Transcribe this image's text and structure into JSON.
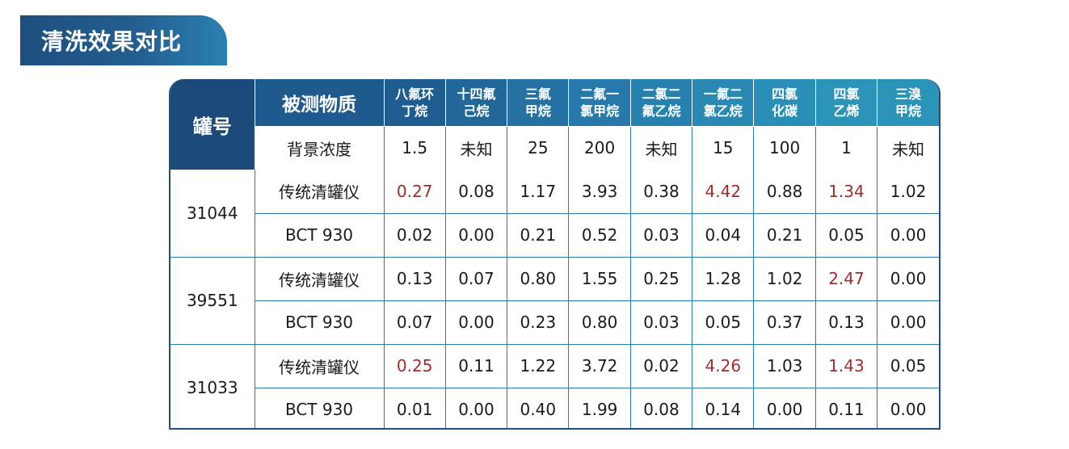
{
  "title": "清洗效果对比",
  "table": {
    "corner_label": "罐号",
    "property_label": "被测物质",
    "columns": [
      "八氟环\n丁烷",
      "十四氟\n己烷",
      "三氟\n甲烷",
      "二氟一\n氯甲烷",
      "二氯二\n氟乙烷",
      "一氟二\n氯乙烷",
      "四氯\n化碳",
      "四氯\n乙烯",
      "三溴\n甲烷"
    ],
    "background_row": {
      "label": "背景浓度",
      "values": [
        "1.5",
        "未知",
        "25",
        "200",
        "未知",
        "15",
        "100",
        "1",
        "未知"
      ]
    },
    "tanks": [
      {
        "id": "31044",
        "rows": [
          {
            "label": "传统清罐仪",
            "values": [
              "0.27",
              "0.08",
              "1.17",
              "3.93",
              "0.38",
              "4.42",
              "0.88",
              "1.34",
              "1.02"
            ],
            "highlight": [
              0,
              5,
              7
            ]
          },
          {
            "label": "BCT 930",
            "values": [
              "0.02",
              "0.00",
              "0.21",
              "0.52",
              "0.03",
              "0.04",
              "0.21",
              "0.05",
              "0.00"
            ],
            "highlight": []
          }
        ]
      },
      {
        "id": "39551",
        "rows": [
          {
            "label": "传统清罐仪",
            "values": [
              "0.13",
              "0.07",
              "0.80",
              "1.55",
              "0.25",
              "1.28",
              "1.02",
              "2.47",
              "0.00"
            ],
            "highlight": [
              7
            ]
          },
          {
            "label": "BCT 930",
            "values": [
              "0.07",
              "0.00",
              "0.23",
              "0.80",
              "0.03",
              "0.05",
              "0.37",
              "0.13",
              "0.00"
            ],
            "highlight": []
          }
        ]
      },
      {
        "id": "31033",
        "rows": [
          {
            "label": "传统清罐仪",
            "values": [
              "0.25",
              "0.11",
              "1.22",
              "3.72",
              "0.02",
              "4.26",
              "1.03",
              "1.43",
              "0.05"
            ],
            "highlight": [
              0,
              5,
              7
            ]
          },
          {
            "label": "BCT 930",
            "values": [
              "0.01",
              "0.00",
              "0.40",
              "1.99",
              "0.08",
              "0.14",
              "0.00",
              "0.11",
              "0.00"
            ],
            "highlight": []
          }
        ]
      }
    ]
  },
  "colors": {
    "header_dark": "#1b4a78",
    "header_light": "#2b93b8",
    "grid_line": "#2a7aa6",
    "highlight_value": "#a52a2a"
  }
}
